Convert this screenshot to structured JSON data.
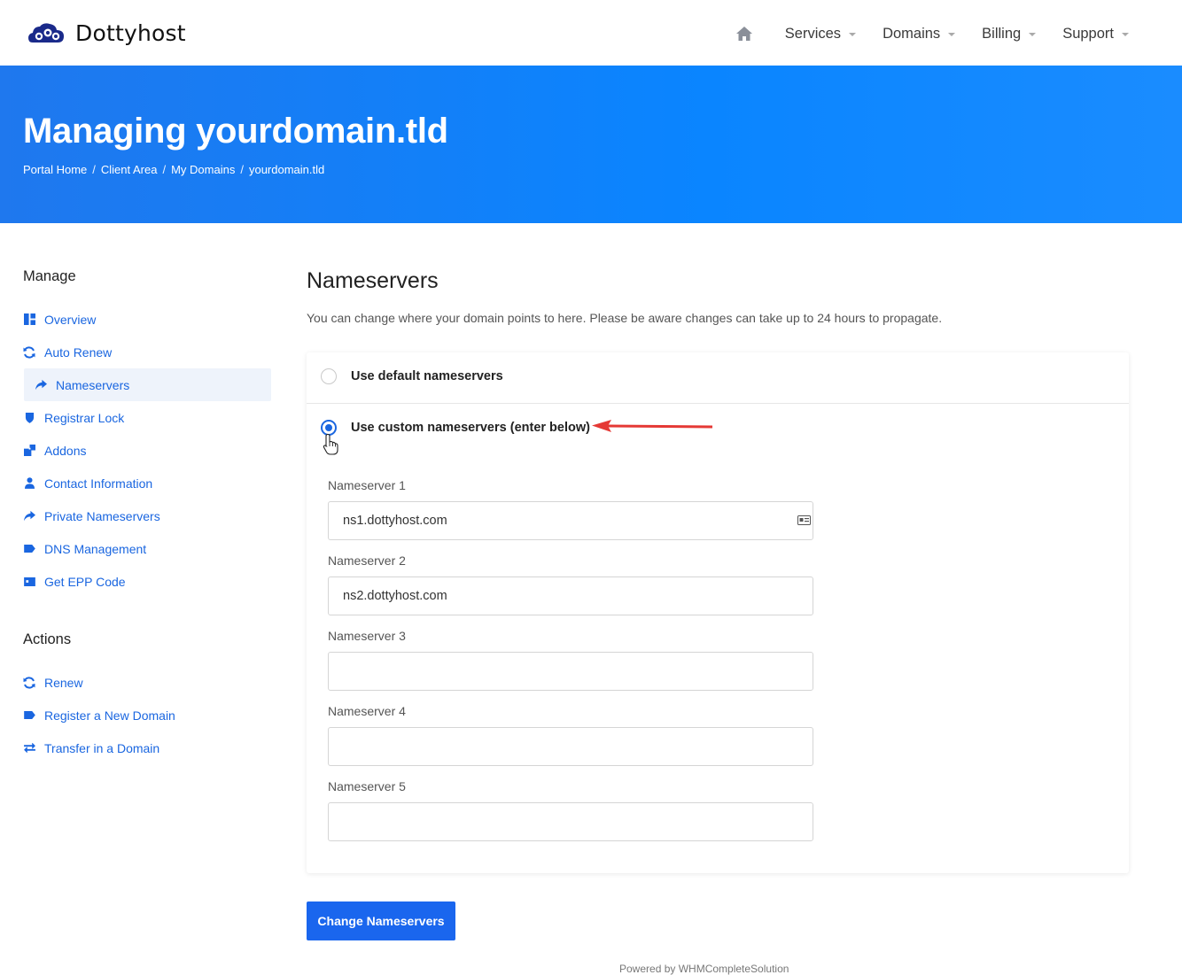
{
  "brand": {
    "name": "Dottyhost"
  },
  "nav": {
    "items": [
      {
        "label": "Services"
      },
      {
        "label": "Domains"
      },
      {
        "label": "Billing"
      },
      {
        "label": "Support"
      }
    ]
  },
  "hero": {
    "title": "Managing yourdomain.tld",
    "breadcrumbs": [
      "Portal Home",
      "Client Area",
      "My Domains",
      "yourdomain.tld"
    ]
  },
  "sidebar": {
    "manage_title": "Manage",
    "manage_items": [
      {
        "label": "Overview",
        "icon": "dashboard-icon"
      },
      {
        "label": "Auto Renew",
        "icon": "sync-icon"
      },
      {
        "label": "Nameservers",
        "icon": "share-arrow-icon",
        "active": true
      },
      {
        "label": "Registrar Lock",
        "icon": "shield-icon"
      },
      {
        "label": "Addons",
        "icon": "cubes-icon"
      },
      {
        "label": "Contact Information",
        "icon": "user-icon"
      },
      {
        "label": "Private Nameservers",
        "icon": "share-arrow-icon"
      },
      {
        "label": "DNS Management",
        "icon": "tag-icon"
      },
      {
        "label": "Get EPP Code",
        "icon": "id-card-icon"
      }
    ],
    "actions_title": "Actions",
    "action_items": [
      {
        "label": "Renew",
        "icon": "sync-icon"
      },
      {
        "label": "Register a New Domain",
        "icon": "tag-icon"
      },
      {
        "label": "Transfer in a Domain",
        "icon": "exchange-icon"
      }
    ]
  },
  "main": {
    "title": "Nameservers",
    "description": "You can change where your domain points to here. Please be aware changes can take up to 24 hours to propagate.",
    "option_default": "Use default nameservers",
    "option_custom": "Use custom nameservers (enter below)",
    "selected_option": "custom",
    "fields": [
      {
        "label": "Nameserver 1",
        "value": "ns1.dottyhost.com"
      },
      {
        "label": "Nameserver 2",
        "value": "ns2.dottyhost.com"
      },
      {
        "label": "Nameserver 3",
        "value": ""
      },
      {
        "label": "Nameserver 4",
        "value": ""
      },
      {
        "label": "Nameserver 5",
        "value": ""
      }
    ],
    "submit_label": "Change Nameservers"
  },
  "footer": {
    "text": "Powered by WHMCompleteSolution"
  },
  "colors": {
    "primary": "#1a66ee",
    "link": "#1a66e0",
    "hero_start": "#1f78ee",
    "hero_end": "#1a8cff",
    "arrow": "#e53935"
  }
}
